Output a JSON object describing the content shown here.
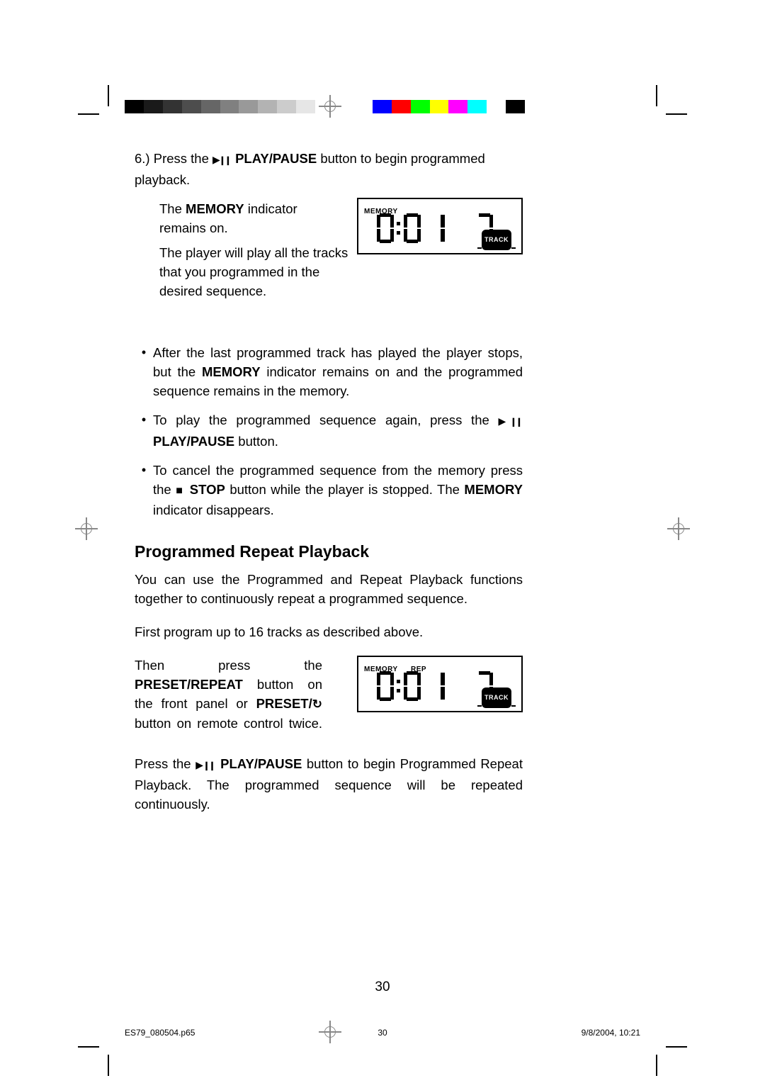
{
  "crop_marks": true,
  "colorbar": [
    "#000000",
    "#1a1a1a",
    "#333333",
    "#4d4d4d",
    "#666666",
    "#808080",
    "#999999",
    "#b3b3b3",
    "#cccccc",
    "#e6e6e6",
    "#ffffff",
    "#ffffff",
    "#0000ff",
    "#ff0000",
    "#00ff00",
    "#ffff00",
    "#ff00ff",
    "#00ffff",
    "#ffffff",
    "#000000"
  ],
  "step6": {
    "num": "6.)",
    "pre": "Press the ",
    "icon_name": "play-pause-icon",
    "bold1": "PLAY/PAUSE",
    "post": " button to begin programmed playback."
  },
  "indent_lines": {
    "l1a": "The ",
    "l1b": "MEMORY",
    "l1c": " indicator remains on.",
    "l2": "The player will play all the tracks that you programmed in the desired sequence."
  },
  "lcd_top": {
    "memory": "MEMORY",
    "rep": "",
    "track_label": "TRACK",
    "digits": "0:0 1  7"
  },
  "bullets": [
    {
      "parts": [
        {
          "t": "After the last programmed track has played the player stops, but the "
        },
        {
          "b": "MEMORY"
        },
        {
          "t": " indicator remains on and the programmed sequence remains in the memory."
        }
      ]
    },
    {
      "parts": [
        {
          "t": "To play the programmed sequence again, press the "
        },
        {
          "icon": "play-pause-icon"
        },
        {
          "b": " PLAY/PAUSE"
        },
        {
          "t": " button."
        }
      ]
    },
    {
      "parts": [
        {
          "t": "To cancel the programmed sequence from the memory press the "
        },
        {
          "icon": "stop-icon"
        },
        {
          "b": " STOP"
        },
        {
          "t": " button while the player is stopped. The "
        },
        {
          "b": "MEMORY"
        },
        {
          "t": " indicator disappears."
        }
      ]
    }
  ],
  "section_heading": "Programmed Repeat Playback",
  "para1": "You can use the Programmed and Repeat Playback functions together to continuously repeat a programmed sequence.",
  "para2": "First program up to 16 tracks as described above.",
  "para3": {
    "pre": "Then press the ",
    "b1": "PRESET/REPEAT",
    "mid": " button on the front panel or ",
    "b2": "PRESET/",
    "icon": "repeat-icon",
    "post": " button on remote control twice."
  },
  "lcd_bottom": {
    "memory": "MEMORY",
    "rep": "REP",
    "track_label": "TRACK",
    "digits": "0:0 1  7"
  },
  "para4": {
    "pre": "Press the ",
    "icon": "play-pause-icon",
    "b1": " PLAY/PAUSE",
    "post": " button to begin Programmed Repeat Playback. The programmed sequence will be repeated continuously."
  },
  "page_number": "30",
  "footer": {
    "file": "ES79_080504.p65",
    "num": "30",
    "date": "9/8/2004, 10:21"
  }
}
